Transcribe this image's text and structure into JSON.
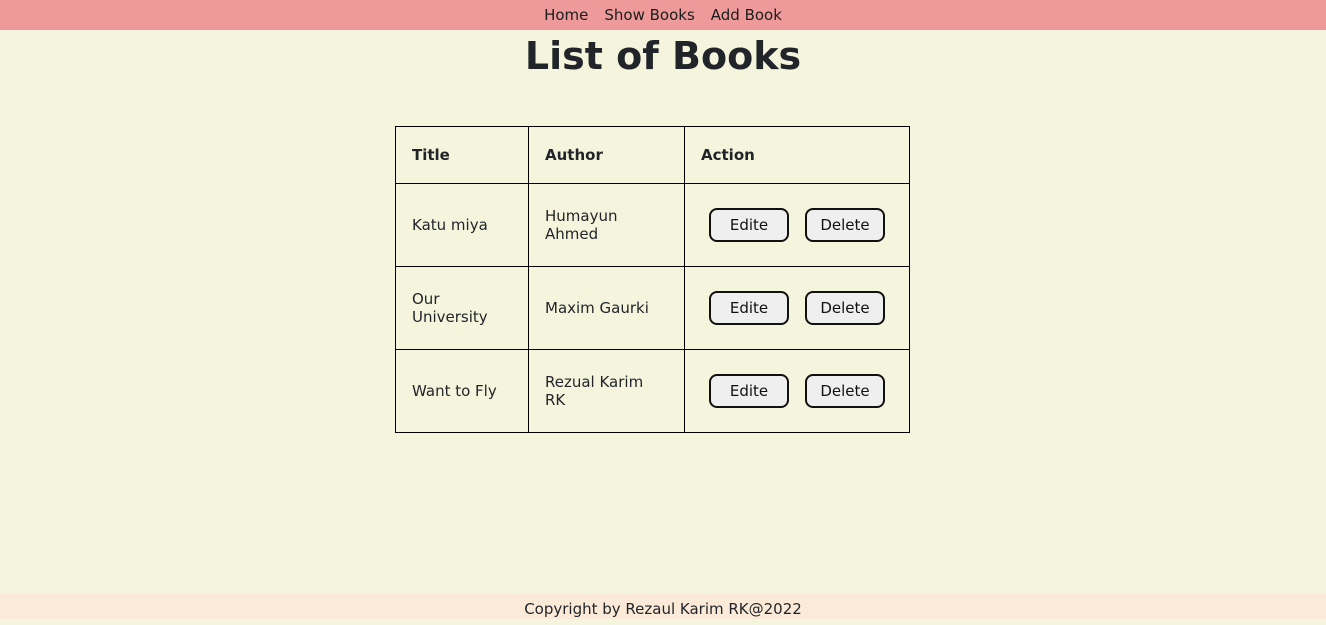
{
  "nav": {
    "items": [
      {
        "label": "Home"
      },
      {
        "label": "Show Books"
      },
      {
        "label": "Add Book"
      }
    ]
  },
  "page": {
    "title": "List of Books"
  },
  "table": {
    "headers": [
      "Title",
      "Author",
      "Action"
    ],
    "rows": [
      {
        "title": "Katu miya",
        "author": "Humayun Ahmed",
        "edit_label": "Edite",
        "delete_label": "Delete"
      },
      {
        "title": "Our University",
        "author": "Maxim Gaurki",
        "edit_label": "Edite",
        "delete_label": "Delete"
      },
      {
        "title": "Want to Fly",
        "author": "Rezual Karim RK",
        "edit_label": "Edite",
        "delete_label": "Delete"
      }
    ]
  },
  "footer": {
    "text": "Copyright by Rezaul Karim RK@2022"
  },
  "colors": {
    "navbar_bg": "#ee9a9a",
    "page_bg": "#f5f5de",
    "footer_bg": "#fbead8",
    "button_bg": "#efefef"
  }
}
